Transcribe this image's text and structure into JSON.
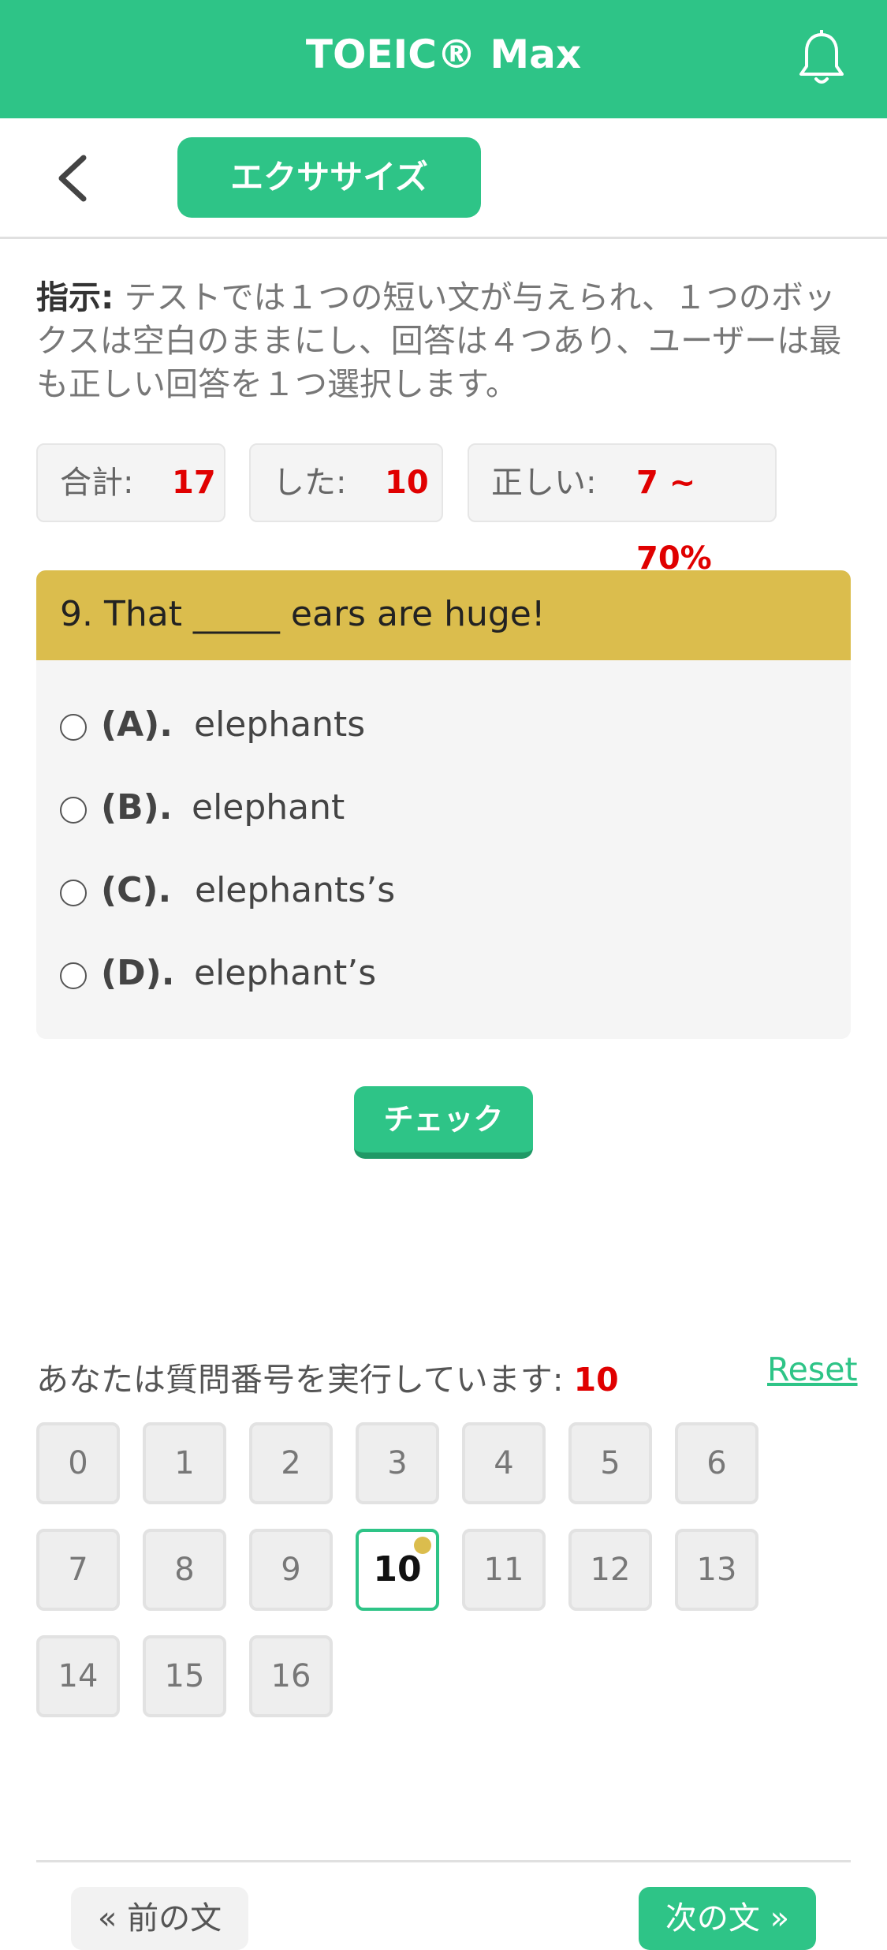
{
  "header": {
    "title": "TOEIC® Max",
    "bell_icon": "bell-icon"
  },
  "subheader": {
    "back_icon": "chevron-left-icon",
    "tab_label": "エクササイズ"
  },
  "instructions": {
    "label": "指示:",
    "text": " テストでは１つの短い文が与えられ、１つのボックスは空白のままにし、回答は４つあり、ユーザーは最も正しい回答を１つ選択します。"
  },
  "stats": {
    "total_label": "合計:",
    "total_value": "17",
    "done_label": "した:",
    "done_value": "10",
    "correct_label": "正しい:",
    "correct_value": "7 ~ 70%"
  },
  "question": {
    "text": "9. That _____ ears are huge!",
    "options": [
      {
        "letter": "(A).",
        "text": "elephants"
      },
      {
        "letter": "(B).",
        "text": "elephant"
      },
      {
        "letter": "(C).",
        "text": "elephants’s"
      },
      {
        "letter": "(D).",
        "text": "elephant’s"
      }
    ]
  },
  "check_label": "チェック",
  "progress": {
    "label": "あなたは質問番号を実行しています:",
    "current": "10",
    "reset_label": "Reset"
  },
  "question_numbers": [
    "0",
    "1",
    "2",
    "3",
    "4",
    "5",
    "6",
    "7",
    "8",
    "9",
    "10",
    "11",
    "12",
    "13",
    "14",
    "15",
    "16"
  ],
  "active_question": "10",
  "nav": {
    "prev_label": "« 前の文",
    "next_label": "次の文 »"
  },
  "colors": {
    "accent": "#2ec487",
    "question_header": "#dbbd4d",
    "highlight": "#e00000"
  }
}
